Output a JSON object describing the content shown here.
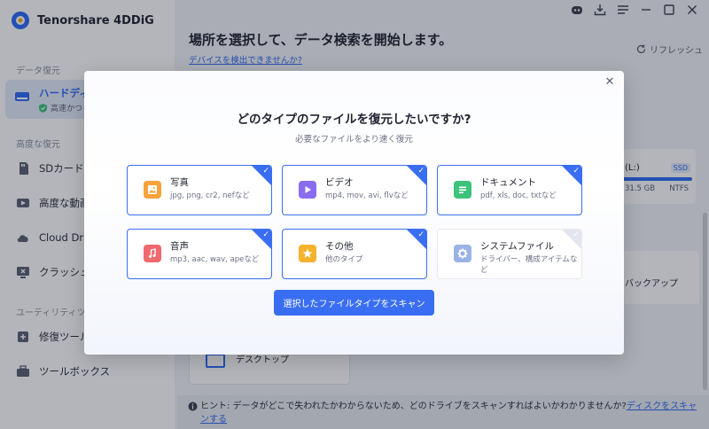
{
  "app": {
    "name": "Tenorshare 4DDiG"
  },
  "sidebar": {
    "section_recovery": "データ復元",
    "active_item": {
      "label": "ハードディ",
      "sub": "高速かつ"
    },
    "section_advanced": "高度な復元",
    "items_advanced": [
      {
        "label": "SDカード",
        "icon": "sd-card-icon"
      },
      {
        "label": "高度な動画",
        "icon": "video-icon"
      },
      {
        "label": "Cloud Driv",
        "icon": "cloud-icon"
      },
      {
        "label": "クラッシュ",
        "icon": "crash-icon"
      }
    ],
    "section_utility": "ユーティリティツー",
    "items_utility": [
      {
        "label": "修復ツール",
        "icon": "repair-icon"
      },
      {
        "label": "ツールボックス",
        "icon": "toolbox-icon"
      }
    ]
  },
  "main": {
    "title": "場所を選択して、データ検索を開始します。",
    "device_link": "デバイスを検出できませんか?",
    "refresh": "リフレッシュ",
    "drive": {
      "name": "(L:)",
      "type": "SSD",
      "size": "31.5 GB",
      "fs": "NTFS"
    },
    "backup_label": "バックアップ",
    "desktop_label": "デスクトップ",
    "hint_prefix": "ヒント: データがどこで失われたかわからないため、どのドライブをスキャンすればよいかわかりませんか?",
    "hint_link": "ディスクをスキャンする"
  },
  "modal": {
    "title": "どのタイプのファイルを復元したいですか?",
    "subtitle": "必要なファイルをより速く復元",
    "close_label": "✕",
    "file_types": [
      {
        "name": "写真",
        "extensions": "jpg, png, cr2, nefなど",
        "selected": true,
        "icon": "photo-icon",
        "color": "#f7a23b"
      },
      {
        "name": "ビデオ",
        "extensions": "mp4, mov, avi, flvなど",
        "selected": true,
        "icon": "video-play-icon",
        "color": "#8a6cf0"
      },
      {
        "name": "ドキュメント",
        "extensions": "pdf, xls, doc, txtなど",
        "selected": true,
        "icon": "document-icon",
        "color": "#3cc27a"
      },
      {
        "name": "音声",
        "extensions": "mp3, aac, wav, apeなど",
        "selected": true,
        "icon": "music-icon",
        "color": "#f0686f"
      },
      {
        "name": "その他",
        "extensions": "他のタイプ",
        "selected": true,
        "icon": "star-icon",
        "color": "#f5b22c"
      },
      {
        "name": "システムファイル",
        "extensions": "ドライバー、構成アイテムなど",
        "selected": false,
        "icon": "gear-icon",
        "color": "#9ab3e6"
      }
    ],
    "scan_button": "選択したファイルタイプをスキャン"
  },
  "colors": {
    "accent": "#3a6ef2"
  }
}
